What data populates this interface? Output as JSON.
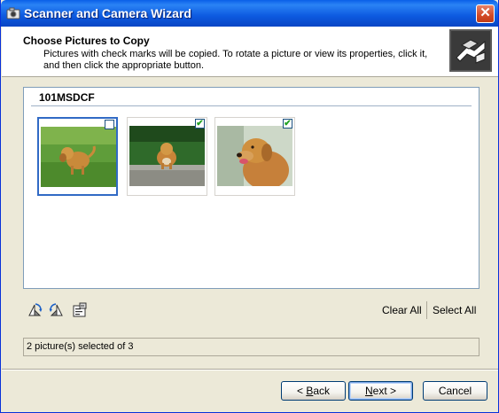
{
  "window": {
    "title": "Scanner and Camera Wizard",
    "close_label": "✕",
    "accent": "#0a5fe8"
  },
  "header": {
    "title": "Choose Pictures to Copy",
    "description": "Pictures with check marks will be copied. To rotate a picture or view its properties, click it, and then click the appropriate button."
  },
  "pictures": {
    "folder": "101MSDCF",
    "items": [
      {
        "name": "dog-on-grass",
        "checked": false,
        "selected": true
      },
      {
        "name": "dog-in-garden",
        "checked": true,
        "selected": false
      },
      {
        "name": "dog-portrait",
        "checked": true,
        "selected": false
      }
    ]
  },
  "toolbar": {
    "rotate_right_icon": "rotate-clockwise-icon",
    "rotate_left_icon": "rotate-counterclockwise-icon",
    "properties_icon": "properties-icon",
    "clear_all": "Clear All",
    "select_all": "Select All"
  },
  "status": {
    "text": "2 picture(s) selected of 3"
  },
  "buttons": {
    "back_accel": "B",
    "back_rest": "ack",
    "next_accel": "N",
    "next_rest": "ext",
    "cancel": "Cancel"
  }
}
